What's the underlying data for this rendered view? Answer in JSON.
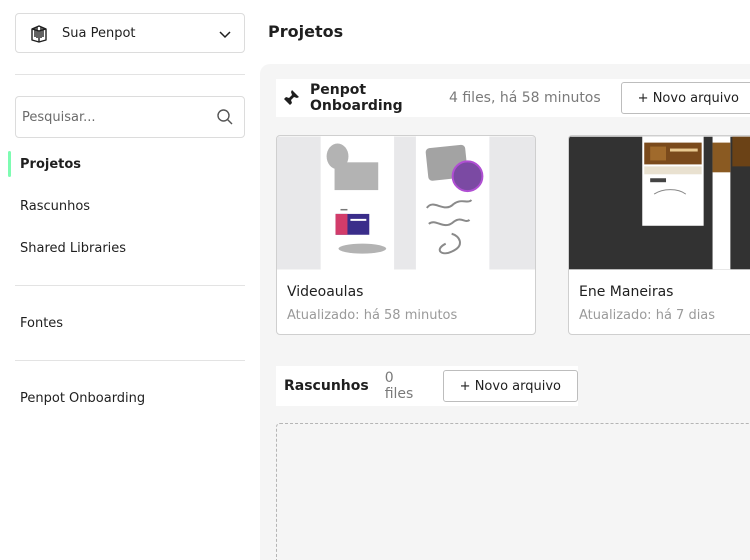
{
  "sidebar": {
    "team": {
      "name": "Sua Penpot",
      "icon": "shopping-bag-icon"
    },
    "search": {
      "placeholder": "Pesquisar...",
      "value": ""
    },
    "nav": [
      {
        "label": "Projetos",
        "active": true
      },
      {
        "label": "Rascunhos",
        "active": false
      },
      {
        "label": "Shared Libraries",
        "active": false
      }
    ],
    "fonts_label": "Fontes",
    "pinned_projects": [
      {
        "label": "Penpot Onboarding"
      }
    ],
    "accent_color": "#7efcb2"
  },
  "main": {
    "title": "Projetos",
    "project": {
      "name": "Penpot Onboarding",
      "meta": "4 files, há 58 minutos",
      "new_file_label": "+ Novo arquivo",
      "pin_icon": "pin-icon",
      "files": [
        {
          "title": "Videoaulas",
          "updated": "Atualizado: há 58 minutos"
        },
        {
          "title": "Ene Maneiras",
          "updated": "Atualizado: há 7 dias"
        }
      ]
    },
    "drafts": {
      "title": "Rascunhos",
      "count": "0 files",
      "new_file_label": "+ Novo arquivo"
    }
  }
}
